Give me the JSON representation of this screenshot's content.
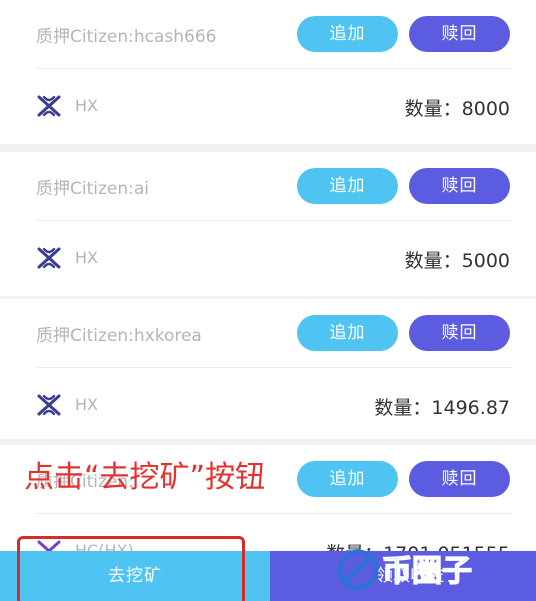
{
  "stakes": [
    {
      "pledge": "质押Citizen:hcash666",
      "add_label": "追加",
      "redeem_label": "赎回",
      "token": "HX",
      "quantity": "数量：8000"
    },
    {
      "pledge": "质押Citizen:ai",
      "add_label": "追加",
      "redeem_label": "赎回",
      "token": "HX",
      "quantity": "数量：5000"
    },
    {
      "pledge": "质押Citizen:hxkorea",
      "add_label": "追加",
      "redeem_label": "赎回",
      "token": "HX",
      "quantity": "数量：1496.87"
    },
    {
      "pledge": "质押Citizen:",
      "add_label": "追加",
      "redeem_label": "赎回",
      "token": "HC(HX)",
      "quantity": "数量：1701.051555"
    }
  ],
  "annotation": "点击“去挖矿”按钮",
  "footer": {
    "mine_label": "去挖矿",
    "collect_label": "领取收益"
  },
  "watermark": {
    "text": "币圈子"
  },
  "colors": {
    "add_button": "#4fc4f2",
    "redeem_button": "#5b5ce0",
    "annotation": "#e5312d",
    "hx_icon": "#3a3d8f"
  },
  "icons": {
    "token": "hx-logo-icon"
  }
}
